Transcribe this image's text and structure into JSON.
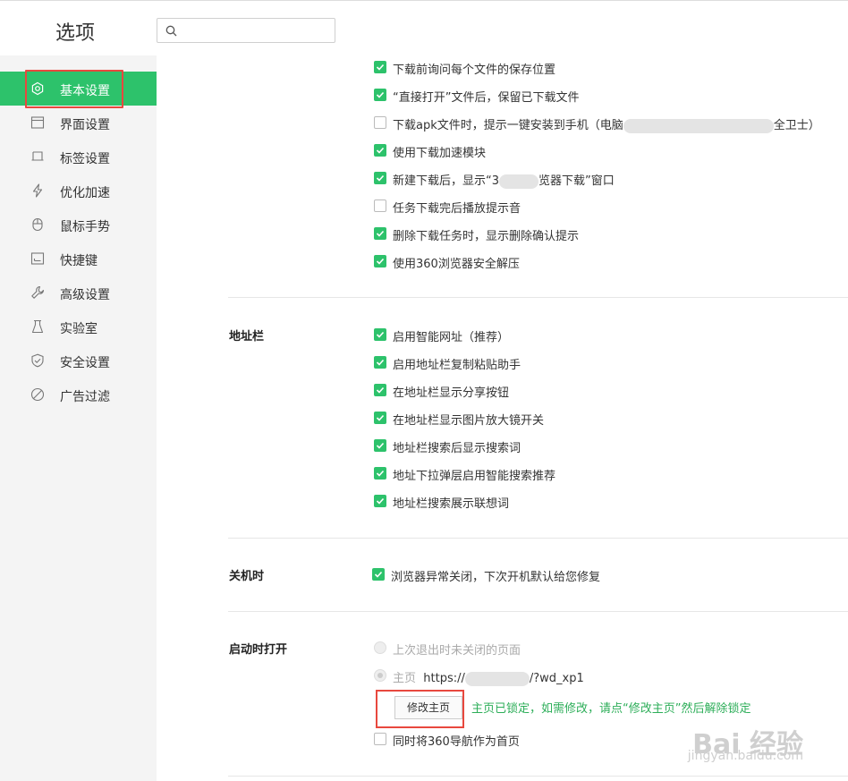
{
  "app_title": "选项",
  "search": {
    "placeholder": "",
    "icon": "search-icon"
  },
  "colors": {
    "accent": "#2dc26b",
    "highlight": "#e8483e",
    "note_green": "#2dae59"
  },
  "sidebar": {
    "items": [
      {
        "label": "基本设置",
        "icon": "gear-icon",
        "active": true
      },
      {
        "label": "界面设置",
        "icon": "window-icon"
      },
      {
        "label": "标签设置",
        "icon": "tab-icon"
      },
      {
        "label": "优化加速",
        "icon": "lightning-icon"
      },
      {
        "label": "鼠标手势",
        "icon": "mouse-icon"
      },
      {
        "label": "快捷键",
        "icon": "keyboard-icon"
      },
      {
        "label": "高级设置",
        "icon": "wrench-icon"
      },
      {
        "label": "实验室",
        "icon": "flask-icon"
      },
      {
        "label": "安全设置",
        "icon": "shield-icon"
      },
      {
        "label": "广告过滤",
        "icon": "block-icon"
      }
    ]
  },
  "download": {
    "options": [
      {
        "label": "下载前询问每个文件的保存位置",
        "checked": true
      },
      {
        "label": "“直接打开”文件后，保留已下载文件",
        "checked": true
      },
      {
        "label_start": "下载apk文件时，提示一键安装到手机（电脑",
        "label_end": "全卫士）",
        "checked": false
      },
      {
        "label": "使用下载加速模块",
        "checked": true
      },
      {
        "label_start": "新建下载后，显示“3",
        "label_end": "览器下载”窗口",
        "checked": true
      },
      {
        "label": "任务下载完后播放提示音",
        "checked": false
      },
      {
        "label": "删除下载任务时，显示删除确认提示",
        "checked": true
      },
      {
        "label": "使用360浏览器安全解压",
        "checked": true
      }
    ]
  },
  "address_bar": {
    "title": "地址栏",
    "options": [
      {
        "label": "启用智能网址（推荐）",
        "checked": true
      },
      {
        "label": "启用地址栏复制粘贴助手",
        "checked": true
      },
      {
        "label": "在地址栏显示分享按钮",
        "checked": true
      },
      {
        "label": "在地址栏显示图片放大镜开关",
        "checked": true
      },
      {
        "label": "地址栏搜索后显示搜索词",
        "checked": true
      },
      {
        "label": "地址下拉弹层启用智能搜索推荐",
        "checked": true
      },
      {
        "label": "地址栏搜索展示联想词",
        "checked": true
      }
    ]
  },
  "shutdown": {
    "title": "关机时",
    "options": [
      {
        "label": "浏览器异常关闭，下次开机默认给您修复",
        "checked": true
      }
    ]
  },
  "startup": {
    "title": "启动时打开",
    "radio_last_session": "上次退出时未关闭的页面",
    "radio_home_label": "主页",
    "home_url_start": "https://",
    "home_url_end": "/?wd_xp1",
    "change_home_button": "修改主页",
    "lock_note": "主页已锁定，如需修改，请点“修改主页”然后解除锁定",
    "nav_as_home": "同时将360导航作为首页",
    "nav_as_home_checked": false
  },
  "watermark": {
    "brand": "Bai 经验",
    "url": "jingyan.baidu.com"
  }
}
